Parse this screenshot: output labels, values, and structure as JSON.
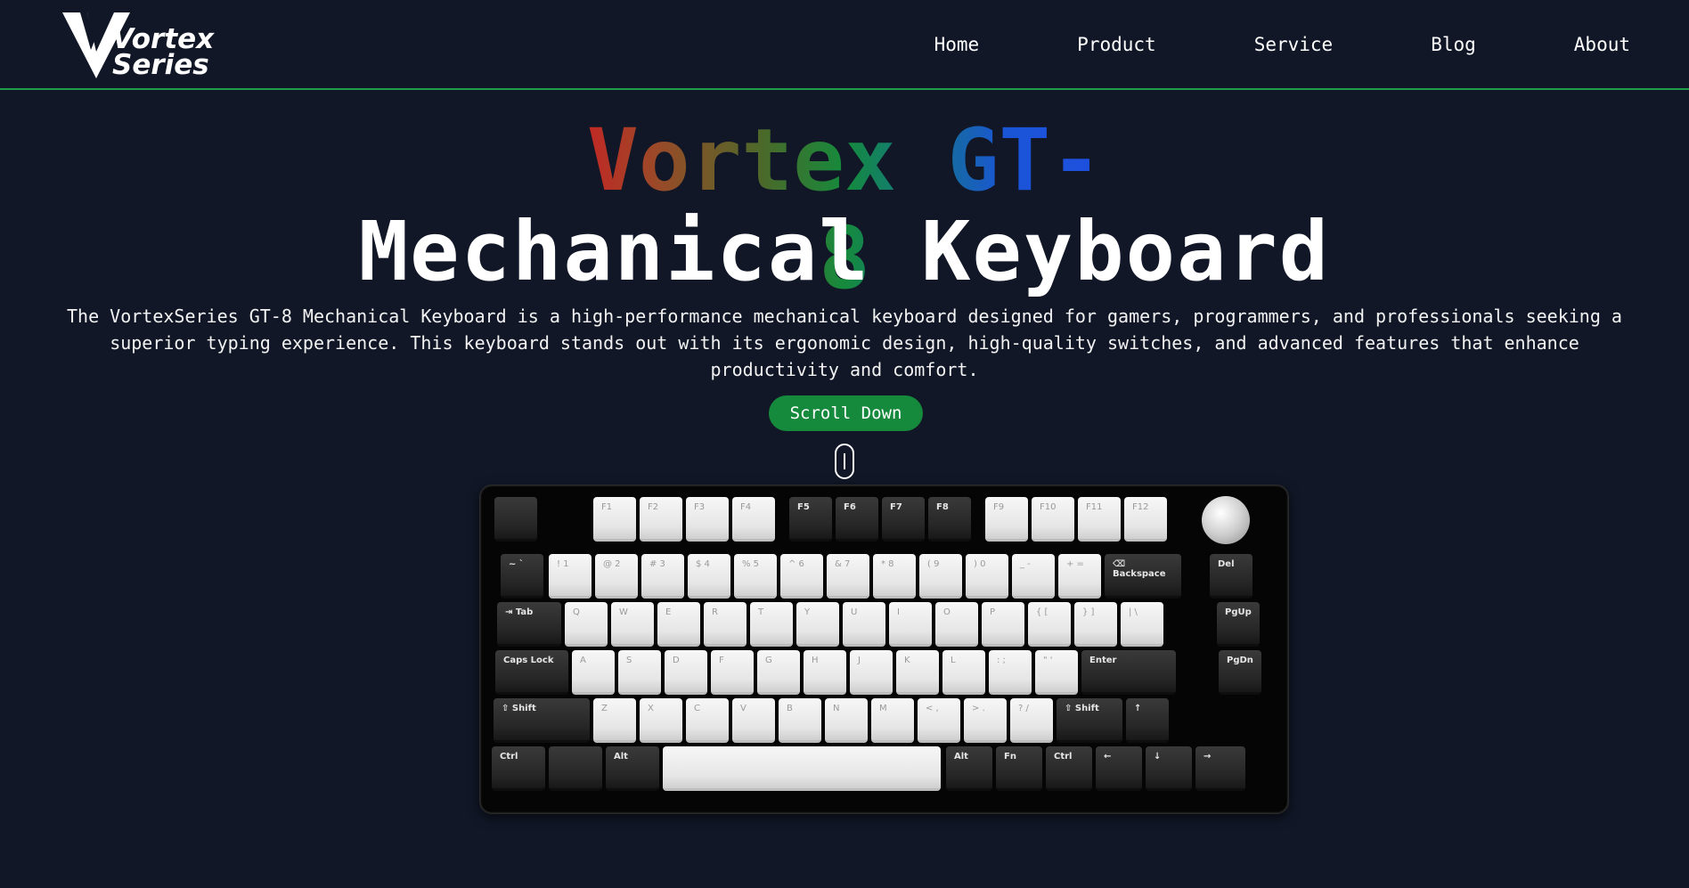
{
  "brand": {
    "logo_text": "Vortex\nSeries"
  },
  "nav": {
    "items": [
      "Home",
      "Product",
      "Service",
      "Blog",
      "About"
    ]
  },
  "hero": {
    "title_line1": "Vortex GT-8",
    "title_line2": "Mechanical Keyboard",
    "description": "The VortexSeries GT-8 Mechanical Keyboard is a high-performance mechanical keyboard designed for gamers, programmers, and professionals seeking a superior typing experience. This keyboard stands out with its ergonomic design, high-quality switches, and advanced features that enhance productivity and comfort.",
    "scroll_button": "Scroll Down",
    "gradient_colors": [
      "#c62424",
      "#158a3c",
      "#1f4fe0"
    ]
  },
  "colors": {
    "background": "#111727",
    "accent": "#158a3c",
    "divider": "#1f9d4a"
  },
  "keyboard": {
    "icon": "mechanical-keyboard-image",
    "rows": [
      [
        "",
        "F1",
        "F2",
        "F3",
        "F4",
        "F5",
        "F6",
        "F7",
        "F8",
        "F9",
        "F10",
        "F11",
        "F12"
      ],
      [
        "~ `",
        "! 1",
        "@ 2",
        "# 3",
        "$ 4",
        "% 5",
        "^ 6",
        "& 7",
        "* 8",
        "( 9",
        ") 0",
        "_ -",
        "+ =",
        "⌫ Backspace",
        "Del"
      ],
      [
        "⇥ Tab",
        "Q",
        "W",
        "E",
        "R",
        "T",
        "Y",
        "U",
        "I",
        "O",
        "P",
        "{ [",
        "} ]",
        "| \\",
        "PgUp"
      ],
      [
        "Caps Lock",
        "A",
        "S",
        "D",
        "F",
        "G",
        "H",
        "J",
        "K",
        "L",
        ": ;",
        "\" '",
        "Enter",
        "PgDn"
      ],
      [
        "⇧ Shift",
        "Z",
        "X",
        "C",
        "V",
        "B",
        "N",
        "M",
        "< ,",
        "> .",
        "? /",
        "⇧ Shift",
        "↑"
      ],
      [
        "Ctrl",
        "",
        "Alt",
        "",
        "Alt",
        "Fn",
        "Ctrl",
        "←",
        "↓",
        "→"
      ]
    ]
  }
}
